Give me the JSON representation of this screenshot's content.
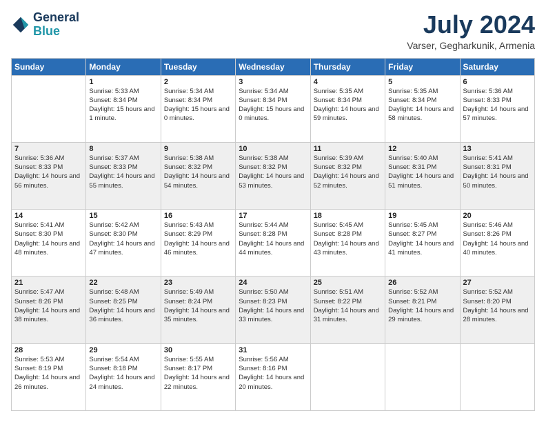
{
  "logo": {
    "line1": "General",
    "line2": "Blue"
  },
  "title": "July 2024",
  "location": "Varser, Gegharkunik, Armenia",
  "weekdays": [
    "Sunday",
    "Monday",
    "Tuesday",
    "Wednesday",
    "Thursday",
    "Friday",
    "Saturday"
  ],
  "weeks": [
    [
      {
        "day": "",
        "sunrise": "",
        "sunset": "",
        "daylight": ""
      },
      {
        "day": "1",
        "sunrise": "Sunrise: 5:33 AM",
        "sunset": "Sunset: 8:34 PM",
        "daylight": "Daylight: 15 hours and 1 minute."
      },
      {
        "day": "2",
        "sunrise": "Sunrise: 5:34 AM",
        "sunset": "Sunset: 8:34 PM",
        "daylight": "Daylight: 15 hours and 0 minutes."
      },
      {
        "day": "3",
        "sunrise": "Sunrise: 5:34 AM",
        "sunset": "Sunset: 8:34 PM",
        "daylight": "Daylight: 15 hours and 0 minutes."
      },
      {
        "day": "4",
        "sunrise": "Sunrise: 5:35 AM",
        "sunset": "Sunset: 8:34 PM",
        "daylight": "Daylight: 14 hours and 59 minutes."
      },
      {
        "day": "5",
        "sunrise": "Sunrise: 5:35 AM",
        "sunset": "Sunset: 8:34 PM",
        "daylight": "Daylight: 14 hours and 58 minutes."
      },
      {
        "day": "6",
        "sunrise": "Sunrise: 5:36 AM",
        "sunset": "Sunset: 8:33 PM",
        "daylight": "Daylight: 14 hours and 57 minutes."
      }
    ],
    [
      {
        "day": "7",
        "sunrise": "Sunrise: 5:36 AM",
        "sunset": "Sunset: 8:33 PM",
        "daylight": "Daylight: 14 hours and 56 minutes."
      },
      {
        "day": "8",
        "sunrise": "Sunrise: 5:37 AM",
        "sunset": "Sunset: 8:33 PM",
        "daylight": "Daylight: 14 hours and 55 minutes."
      },
      {
        "day": "9",
        "sunrise": "Sunrise: 5:38 AM",
        "sunset": "Sunset: 8:32 PM",
        "daylight": "Daylight: 14 hours and 54 minutes."
      },
      {
        "day": "10",
        "sunrise": "Sunrise: 5:38 AM",
        "sunset": "Sunset: 8:32 PM",
        "daylight": "Daylight: 14 hours and 53 minutes."
      },
      {
        "day": "11",
        "sunrise": "Sunrise: 5:39 AM",
        "sunset": "Sunset: 8:32 PM",
        "daylight": "Daylight: 14 hours and 52 minutes."
      },
      {
        "day": "12",
        "sunrise": "Sunrise: 5:40 AM",
        "sunset": "Sunset: 8:31 PM",
        "daylight": "Daylight: 14 hours and 51 minutes."
      },
      {
        "day": "13",
        "sunrise": "Sunrise: 5:41 AM",
        "sunset": "Sunset: 8:31 PM",
        "daylight": "Daylight: 14 hours and 50 minutes."
      }
    ],
    [
      {
        "day": "14",
        "sunrise": "Sunrise: 5:41 AM",
        "sunset": "Sunset: 8:30 PM",
        "daylight": "Daylight: 14 hours and 48 minutes."
      },
      {
        "day": "15",
        "sunrise": "Sunrise: 5:42 AM",
        "sunset": "Sunset: 8:30 PM",
        "daylight": "Daylight: 14 hours and 47 minutes."
      },
      {
        "day": "16",
        "sunrise": "Sunrise: 5:43 AM",
        "sunset": "Sunset: 8:29 PM",
        "daylight": "Daylight: 14 hours and 46 minutes."
      },
      {
        "day": "17",
        "sunrise": "Sunrise: 5:44 AM",
        "sunset": "Sunset: 8:28 PM",
        "daylight": "Daylight: 14 hours and 44 minutes."
      },
      {
        "day": "18",
        "sunrise": "Sunrise: 5:45 AM",
        "sunset": "Sunset: 8:28 PM",
        "daylight": "Daylight: 14 hours and 43 minutes."
      },
      {
        "day": "19",
        "sunrise": "Sunrise: 5:45 AM",
        "sunset": "Sunset: 8:27 PM",
        "daylight": "Daylight: 14 hours and 41 minutes."
      },
      {
        "day": "20",
        "sunrise": "Sunrise: 5:46 AM",
        "sunset": "Sunset: 8:26 PM",
        "daylight": "Daylight: 14 hours and 40 minutes."
      }
    ],
    [
      {
        "day": "21",
        "sunrise": "Sunrise: 5:47 AM",
        "sunset": "Sunset: 8:26 PM",
        "daylight": "Daylight: 14 hours and 38 minutes."
      },
      {
        "day": "22",
        "sunrise": "Sunrise: 5:48 AM",
        "sunset": "Sunset: 8:25 PM",
        "daylight": "Daylight: 14 hours and 36 minutes."
      },
      {
        "day": "23",
        "sunrise": "Sunrise: 5:49 AM",
        "sunset": "Sunset: 8:24 PM",
        "daylight": "Daylight: 14 hours and 35 minutes."
      },
      {
        "day": "24",
        "sunrise": "Sunrise: 5:50 AM",
        "sunset": "Sunset: 8:23 PM",
        "daylight": "Daylight: 14 hours and 33 minutes."
      },
      {
        "day": "25",
        "sunrise": "Sunrise: 5:51 AM",
        "sunset": "Sunset: 8:22 PM",
        "daylight": "Daylight: 14 hours and 31 minutes."
      },
      {
        "day": "26",
        "sunrise": "Sunrise: 5:52 AM",
        "sunset": "Sunset: 8:21 PM",
        "daylight": "Daylight: 14 hours and 29 minutes."
      },
      {
        "day": "27",
        "sunrise": "Sunrise: 5:52 AM",
        "sunset": "Sunset: 8:20 PM",
        "daylight": "Daylight: 14 hours and 28 minutes."
      }
    ],
    [
      {
        "day": "28",
        "sunrise": "Sunrise: 5:53 AM",
        "sunset": "Sunset: 8:19 PM",
        "daylight": "Daylight: 14 hours and 26 minutes."
      },
      {
        "day": "29",
        "sunrise": "Sunrise: 5:54 AM",
        "sunset": "Sunset: 8:18 PM",
        "daylight": "Daylight: 14 hours and 24 minutes."
      },
      {
        "day": "30",
        "sunrise": "Sunrise: 5:55 AM",
        "sunset": "Sunset: 8:17 PM",
        "daylight": "Daylight: 14 hours and 22 minutes."
      },
      {
        "day": "31",
        "sunrise": "Sunrise: 5:56 AM",
        "sunset": "Sunset: 8:16 PM",
        "daylight": "Daylight: 14 hours and 20 minutes."
      },
      {
        "day": "",
        "sunrise": "",
        "sunset": "",
        "daylight": ""
      },
      {
        "day": "",
        "sunrise": "",
        "sunset": "",
        "daylight": ""
      },
      {
        "day": "",
        "sunrise": "",
        "sunset": "",
        "daylight": ""
      }
    ]
  ]
}
